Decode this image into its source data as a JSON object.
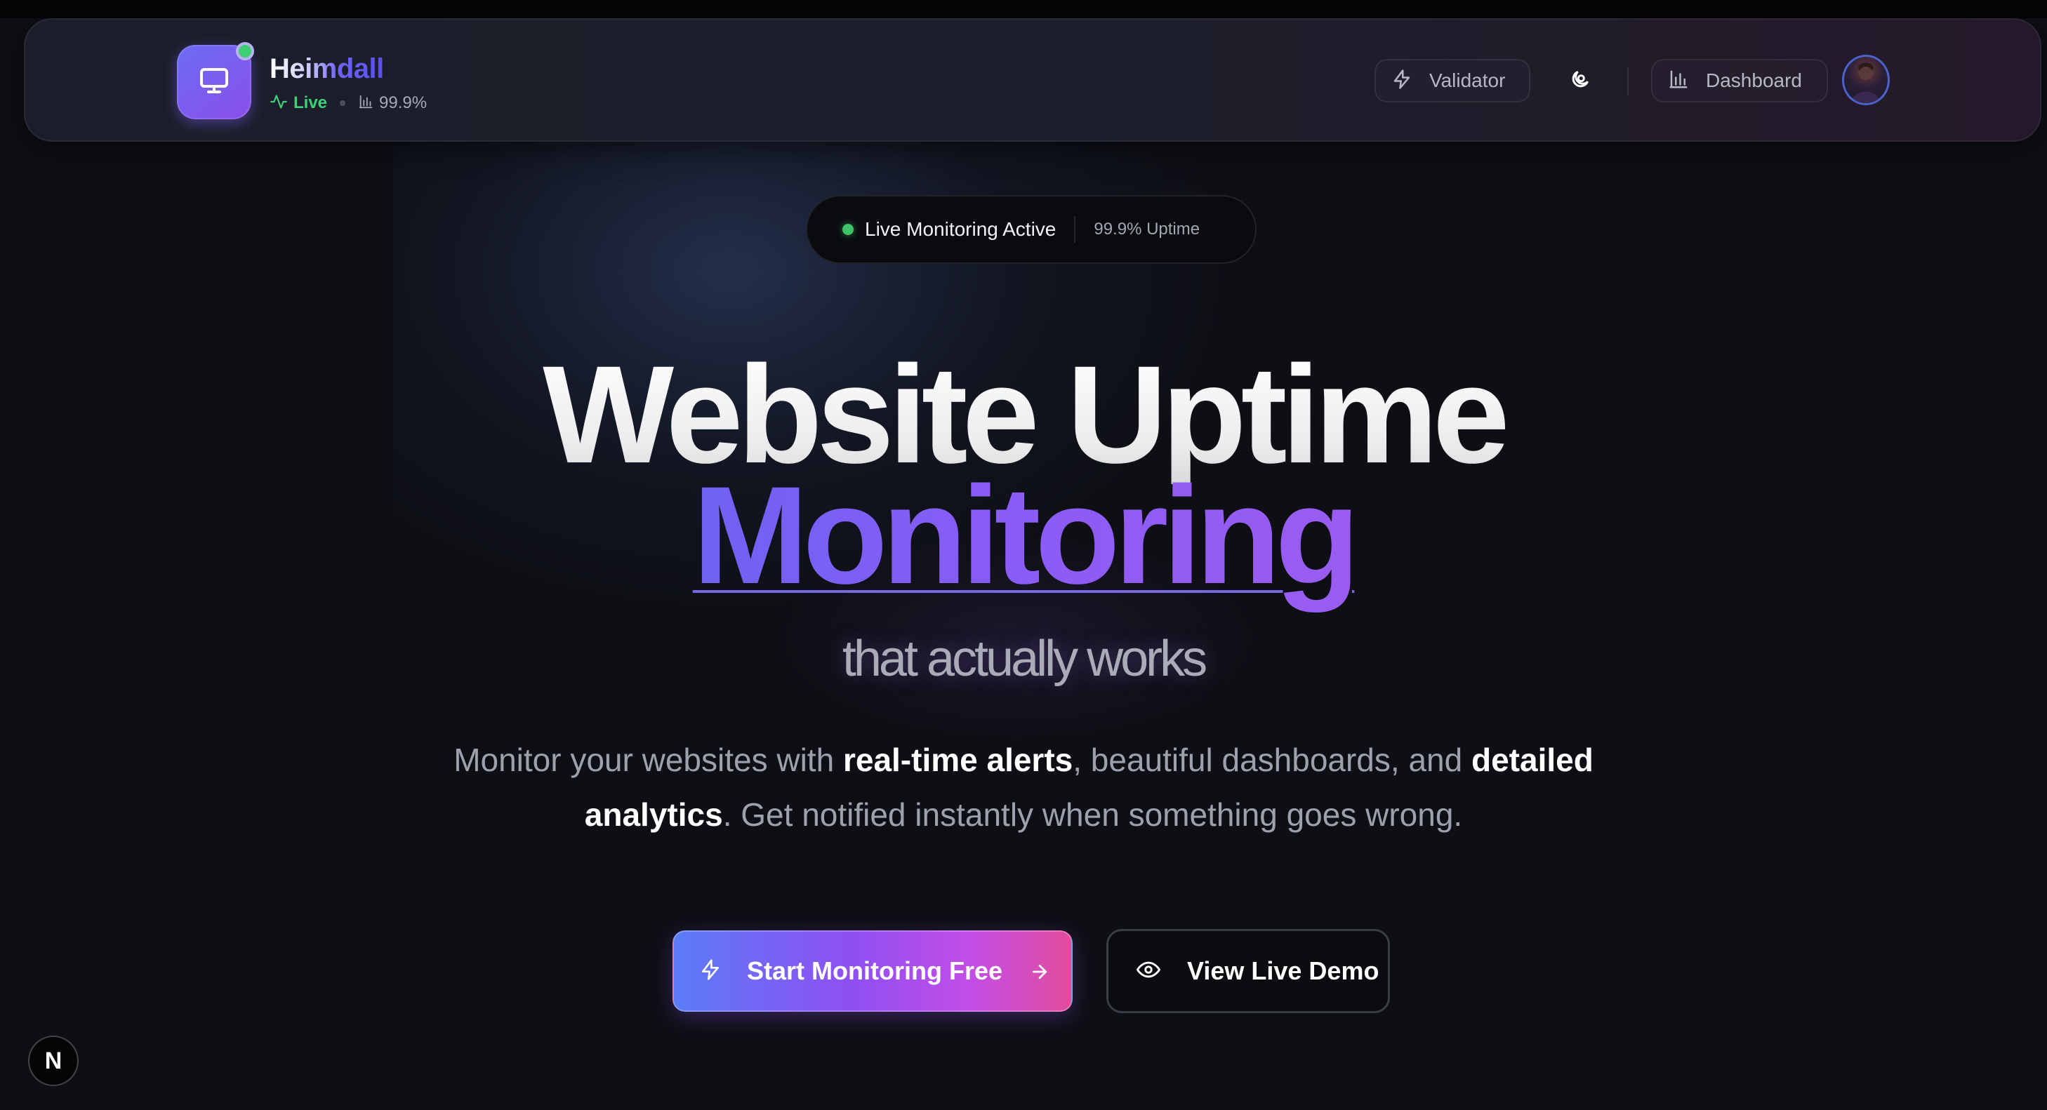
{
  "brand": {
    "name": "Heimdall",
    "status_label": "Live",
    "uptime": "99.9%"
  },
  "nav": {
    "validator_label": "Validator",
    "dashboard_label": "Dashboard"
  },
  "status_pill": {
    "text": "Live Monitoring Active",
    "uptime": "99.9% Uptime"
  },
  "hero": {
    "title_line1": "Website Uptime",
    "title_line2": "Monitoring",
    "tagline": "that actually works",
    "desc_part1": "Monitor your websites with ",
    "desc_bold1": "real-time alerts",
    "desc_part2": ", beautiful dashboards, and ",
    "desc_bold2": "detailed analytics",
    "desc_part3": ". Get notified instantly when something goes wrong."
  },
  "cta": {
    "primary_label": "Start Monitoring Free",
    "secondary_label": "View Live Demo"
  },
  "dev_badge": "N",
  "icons": {
    "logo": "monitor-icon",
    "live": "activity-icon",
    "uptime": "bar-chart-icon",
    "validator": "zap-icon",
    "theme": "theme-toggle-icon",
    "dashboard": "bar-chart-icon",
    "primary_cta": "zap-icon",
    "primary_arrow": "arrow-right-icon",
    "secondary_cta": "eye-icon"
  },
  "colors": {
    "background": "#0e0f15",
    "accent_purple": "#8b5cf6",
    "accent_blue": "#6f62f3",
    "live_green": "#3dd17a",
    "cta_pink": "#e24c9c"
  }
}
